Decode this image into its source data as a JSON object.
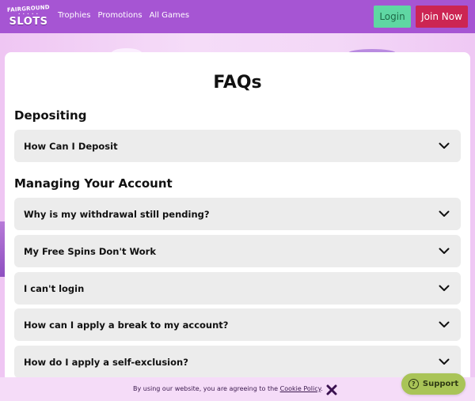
{
  "header": {
    "logo_line1": "FAIRGROUND",
    "logo_dots": "• • • • •",
    "logo_line2": "SLOTS",
    "nav": [
      {
        "label": "Trophies"
      },
      {
        "label": "Promotions"
      },
      {
        "label": "All Games"
      }
    ],
    "login_label": "Login",
    "join_label": "Join Now"
  },
  "main": {
    "title": "FAQs",
    "sections": [
      {
        "title": "Depositing",
        "questions": [
          "How Can I Deposit"
        ]
      },
      {
        "title": "Managing Your Account",
        "questions": [
          "Why is my withdrawal still pending?",
          "My Free Spins Don't Work",
          "I can't login",
          "How can I apply a break to my account?",
          "How do I apply a self-exclusion?"
        ]
      }
    ]
  },
  "cookie": {
    "text": "By using our website, you are agreeing to the ",
    "link": "Cookie Policy",
    "suffix": "."
  },
  "support": {
    "icon": "?",
    "label": "Support"
  },
  "colors": {
    "header_bg": "#a655d3",
    "login_bg": "#5fd7a3",
    "join_bg": "#cc2553",
    "support_bg": "#a9c457",
    "faq_bg": "#ececec"
  }
}
